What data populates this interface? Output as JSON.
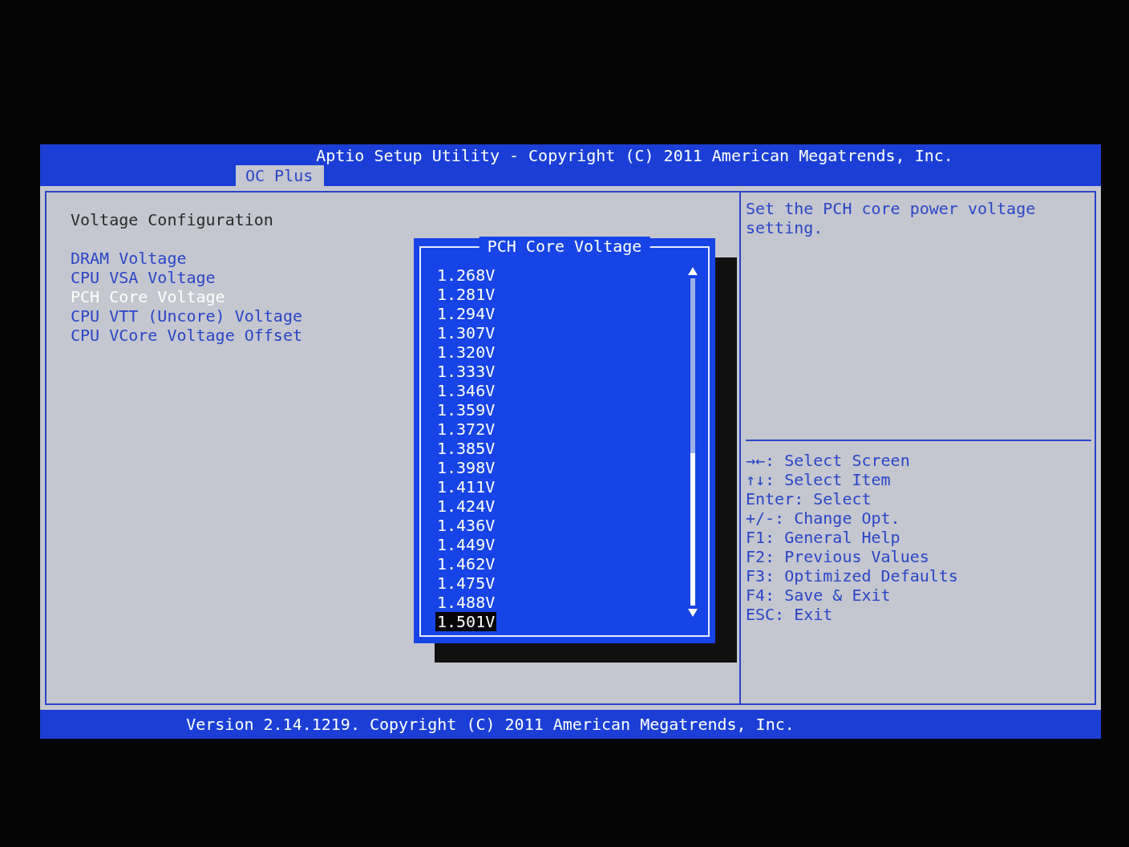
{
  "header": {
    "title": "Aptio Setup Utility - Copyright (C) 2011 American Megatrends, Inc.",
    "tabs": [
      {
        "label": "OC Plus",
        "selected": true
      }
    ]
  },
  "left_pane": {
    "section_title": "Voltage Configuration",
    "items": [
      {
        "label": "DRAM Voltage",
        "selected": false
      },
      {
        "label": "CPU VSA Voltage",
        "selected": false
      },
      {
        "label": "PCH Core Voltage",
        "selected": true
      },
      {
        "label": "CPU VTT (Uncore) Voltage",
        "selected": false
      },
      {
        "label": "CPU VCore Voltage Offset",
        "selected": false
      }
    ]
  },
  "popup": {
    "title": "PCH Core Voltage",
    "options": [
      {
        "label": "1.268V",
        "selected": false
      },
      {
        "label": "1.281V",
        "selected": false
      },
      {
        "label": "1.294V",
        "selected": false
      },
      {
        "label": "1.307V",
        "selected": false
      },
      {
        "label": "1.320V",
        "selected": false
      },
      {
        "label": "1.333V",
        "selected": false
      },
      {
        "label": "1.346V",
        "selected": false
      },
      {
        "label": "1.359V",
        "selected": false
      },
      {
        "label": "1.372V",
        "selected": false
      },
      {
        "label": "1.385V",
        "selected": false
      },
      {
        "label": "1.398V",
        "selected": false
      },
      {
        "label": "1.411V",
        "selected": false
      },
      {
        "label": "1.424V",
        "selected": false
      },
      {
        "label": "1.436V",
        "selected": false
      },
      {
        "label": "1.449V",
        "selected": false
      },
      {
        "label": "1.462V",
        "selected": false
      },
      {
        "label": "1.475V",
        "selected": false
      },
      {
        "label": "1.488V",
        "selected": false
      },
      {
        "label": "1.501V",
        "selected": true
      }
    ]
  },
  "help": {
    "description": "Set the PCH core power voltage setting.",
    "keys": [
      "→←: Select Screen",
      "↑↓: Select Item",
      "Enter: Select",
      "+/-: Change Opt.",
      "F1: General Help",
      "F2: Previous Values",
      "F3: Optimized Defaults",
      "F4: Save & Exit",
      "ESC: Exit"
    ]
  },
  "footer": "Version 2.14.1219. Copyright (C) 2011 American Megatrends, Inc."
}
